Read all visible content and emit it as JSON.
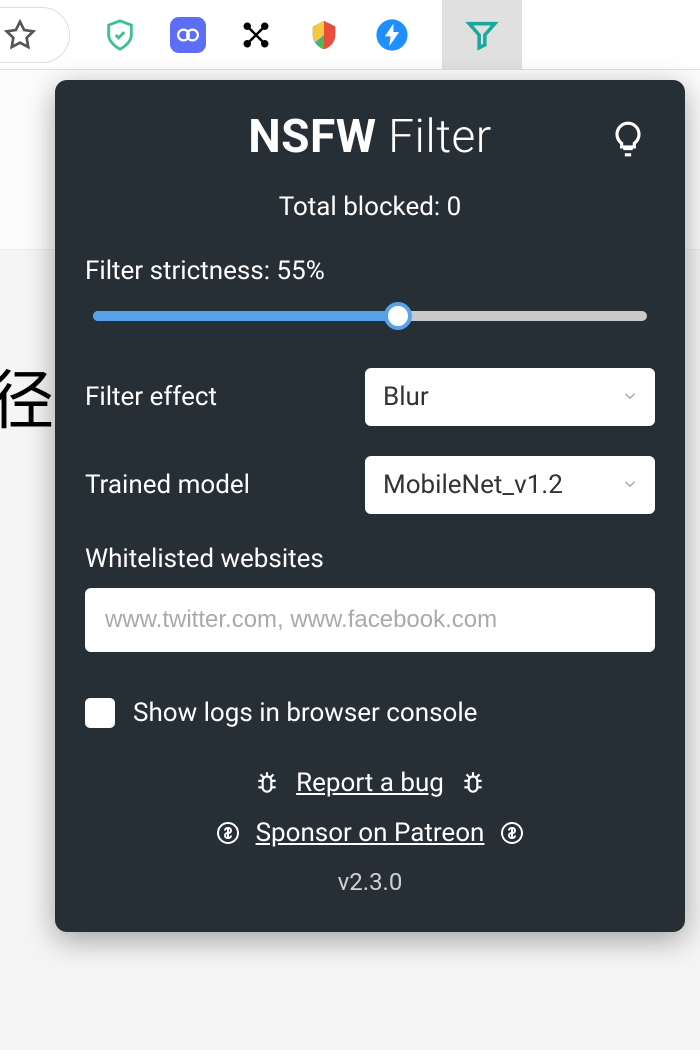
{
  "toolbar": {
    "icons": [
      "star",
      "shield",
      "link-circle",
      "nodes",
      "globe-shield",
      "lightning",
      "filter"
    ]
  },
  "page": {
    "cjk_char": "径"
  },
  "popup": {
    "title_strong": "NSFW",
    "title_light": " Filter",
    "total_blocked_prefix": "Total blocked: ",
    "total_blocked_value": "0",
    "strictness_label_prefix": "Filter strictness: ",
    "strictness_value": "55%",
    "strictness_percent": 55,
    "filter_effect_label": "Filter effect",
    "filter_effect_value": "Blur",
    "trained_model_label": "Trained model",
    "trained_model_value": "MobileNet_v1.2",
    "whitelist_label": "Whitelisted websites",
    "whitelist_placeholder": "www.twitter.com, www.facebook.com",
    "show_logs_label": "Show logs in browser console",
    "report_bug_label": "Report a bug",
    "sponsor_label": "Sponsor on Patreon",
    "version": "v2.3.0"
  }
}
